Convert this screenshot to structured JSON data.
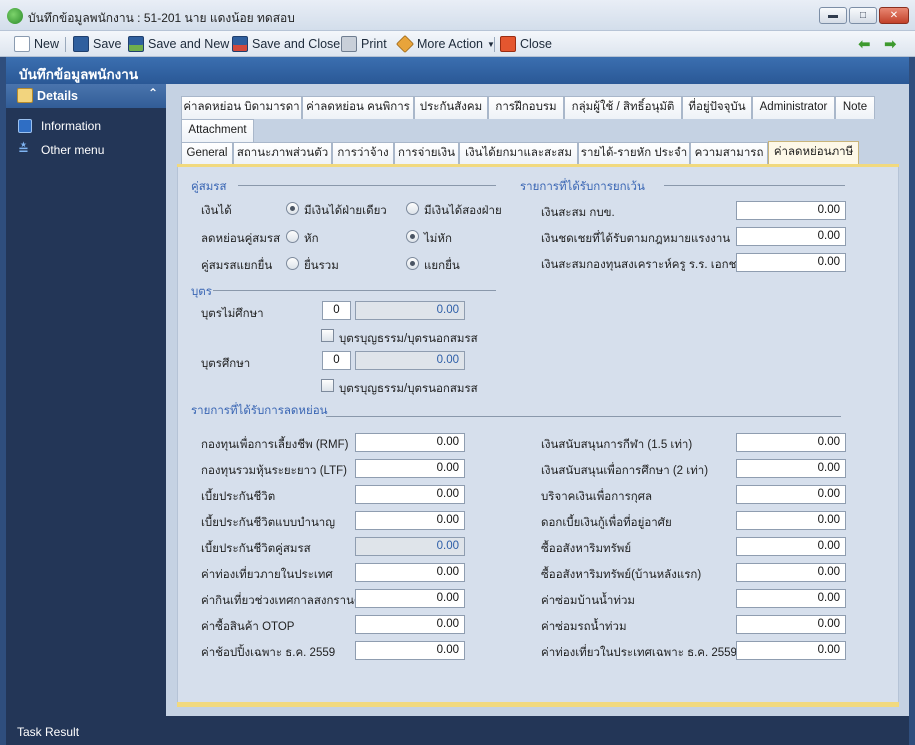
{
  "window": {
    "title": "บันทึกข้อมูลพนักงาน : 51-201 นาย แดงน้อย ทดสอบ"
  },
  "toolbar": {
    "new": "New",
    "save": "Save",
    "save_new": "Save and New",
    "save_close": "Save and Close",
    "print": "Print",
    "more": "More Action",
    "close": "Close"
  },
  "header": {
    "title": "บันทึกข้อมูลพนักงาน"
  },
  "sidebar": {
    "header": "Details",
    "items": [
      {
        "label": "Information",
        "icon": "info-icon"
      },
      {
        "label": "Other menu",
        "icon": "double-chevron-down-icon"
      }
    ]
  },
  "tabs_row1": [
    "ค่าลดหย่อน บิดามารดา",
    "ค่าลดหย่อน คนพิการ",
    "ประกันสังคม",
    "การฝึกอบรม",
    "กลุ่มผู้ใช้ / สิทธิ์อนุมัติ",
    "ที่อยู่ปัจจุบัน",
    "Administrator",
    "Note"
  ],
  "tabs_row2": [
    "Attachment"
  ],
  "tabs_row3": [
    "General",
    "สถานะภาพส่วนตัว",
    "การว่าจ้าง",
    "การจ่ายเงิน",
    "เงินได้ยกมาและสะสม",
    "รายได้-รายหัก ประจำ",
    "ความสามารถ",
    "ค่าลดหย่อนภาษี"
  ],
  "spouse": {
    "section": "คู่สมรส",
    "income_label": "เงินได้",
    "income_opt1": "มีเงินได้ฝ่ายเดียว",
    "income_opt2": "มีเงินได้สองฝ่าย",
    "deduct_label": "ลดหย่อนคู่สมรส",
    "deduct_opt1": "หัก",
    "deduct_opt2": "ไม่หัก",
    "file_label": "คู่สมรสแยกยื่น",
    "file_opt1": "ยื่นรวม",
    "file_opt2": "แยกยื่น"
  },
  "exempt": {
    "section": "รายการที่ได้รับการยกเว้น",
    "items": [
      {
        "label": "เงินสะสม กบข.",
        "value": "0.00"
      },
      {
        "label": "เงินชดเชยที่ได้รับตามกฎหมายแรงงาน",
        "value": "0.00"
      },
      {
        "label": "เงินสะสมกองทุนสงเคราะห์ครู ร.ร. เอกชน",
        "value": "0.00"
      }
    ]
  },
  "children": {
    "section": "บุตร",
    "not_studying_label": "บุตรไม่ศึกษา",
    "not_studying_count": "0",
    "not_studying_amount": "0.00",
    "studying_label": "บุตรศึกษา",
    "studying_count": "0",
    "studying_amount": "0.00",
    "adopted_label": "บุตรบุญธรรม/บุตรนอกสมรส"
  },
  "deductions": {
    "section": "รายการที่ได้รับการลดหย่อน",
    "left": [
      {
        "label": "กองทุนเพื่อการเลี้ยงชีพ (RMF)",
        "value": "0.00"
      },
      {
        "label": "กองทุนรวมหุ้นระยะยาว (LTF)",
        "value": "0.00"
      },
      {
        "label": "เบี้ยประกันชีวิต",
        "value": "0.00"
      },
      {
        "label": "เบี้ยประกันชีวิตแบบบำนาญ",
        "value": "0.00"
      },
      {
        "label": "เบี้ยประกันชีวิตคู่สมรส",
        "value": "0.00"
      },
      {
        "label": "ค่าท่องเที่ยวภายในประเทศ",
        "value": "0.00"
      },
      {
        "label": "ค่ากินเที่ยวช่วงเทศกาลสงกรานต์",
        "value": "0.00"
      },
      {
        "label": "ค่าซื้อสินค้า OTOP",
        "value": "0.00"
      },
      {
        "label": "ค่าช้อปปิ้งเฉพาะ ธ.ค. 2559",
        "value": "0.00"
      }
    ],
    "right": [
      {
        "label": "เงินสนับสนุนการกีฬา (1.5 เท่า)",
        "value": "0.00"
      },
      {
        "label": "เงินสนับสนุนเพื่อการศึกษา (2 เท่า)",
        "value": "0.00"
      },
      {
        "label": "บริจาคเงินเพื่อการกุศล",
        "value": "0.00"
      },
      {
        "label": "ดอกเบี้ยเงินกู้เพื่อที่อยู่อาศัย",
        "value": "0.00"
      },
      {
        "label": "ซื้ออสังหาริมทรัพย์",
        "value": "0.00"
      },
      {
        "label": "ซื้ออสังหาริมทรัพย์(บ้านหลังแรก)",
        "value": "0.00"
      },
      {
        "label": "ค่าซ่อมบ้านน้ำท่วม",
        "value": "0.00"
      },
      {
        "label": "ค่าซ่อมรถน้ำท่วม",
        "value": "0.00"
      },
      {
        "label": "ค่าท่องเที่ยวในประเทศเฉพาะ ธ.ค. 2559",
        "value": "0.00"
      }
    ]
  },
  "status": {
    "text": "Task Result"
  }
}
